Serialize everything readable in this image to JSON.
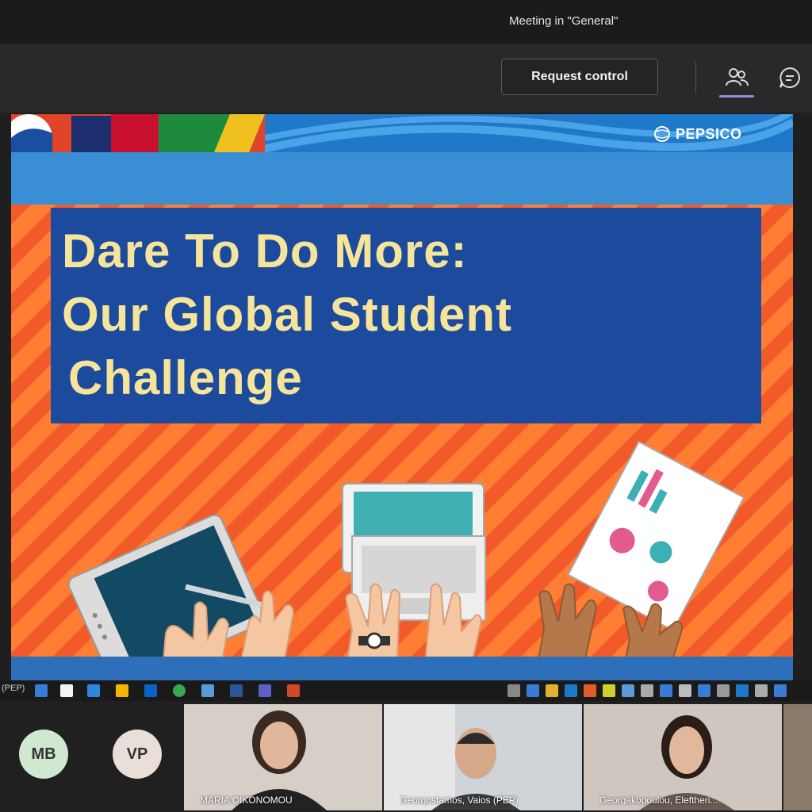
{
  "window": {
    "title": "Meeting in \"General\""
  },
  "toolbar": {
    "request_control_label": "Request control",
    "icons": [
      "people-icon",
      "chat-icon"
    ]
  },
  "slide": {
    "brand": "PEPSICO",
    "title_lines": [
      "Dare To Do More:",
      "Our Global Student",
      "Challenge"
    ],
    "colors": {
      "orange": "#ff7a2d",
      "blue": "#1c4a9c",
      "title_text": "#f6e49b"
    }
  },
  "taskbar": {
    "label": "(PEP)"
  },
  "participants": {
    "avatars": [
      {
        "initials": "MB",
        "color": "#cfe8cf"
      },
      {
        "initials": "VP",
        "color": "#eadfd8"
      }
    ],
    "tiles": [
      {
        "name": "MARIA OIKONOMOU"
      },
      {
        "name": "Georgostamos, Vaios (PEP)"
      },
      {
        "name": "Georgakopoulou, Eleftheri..."
      }
    ]
  }
}
